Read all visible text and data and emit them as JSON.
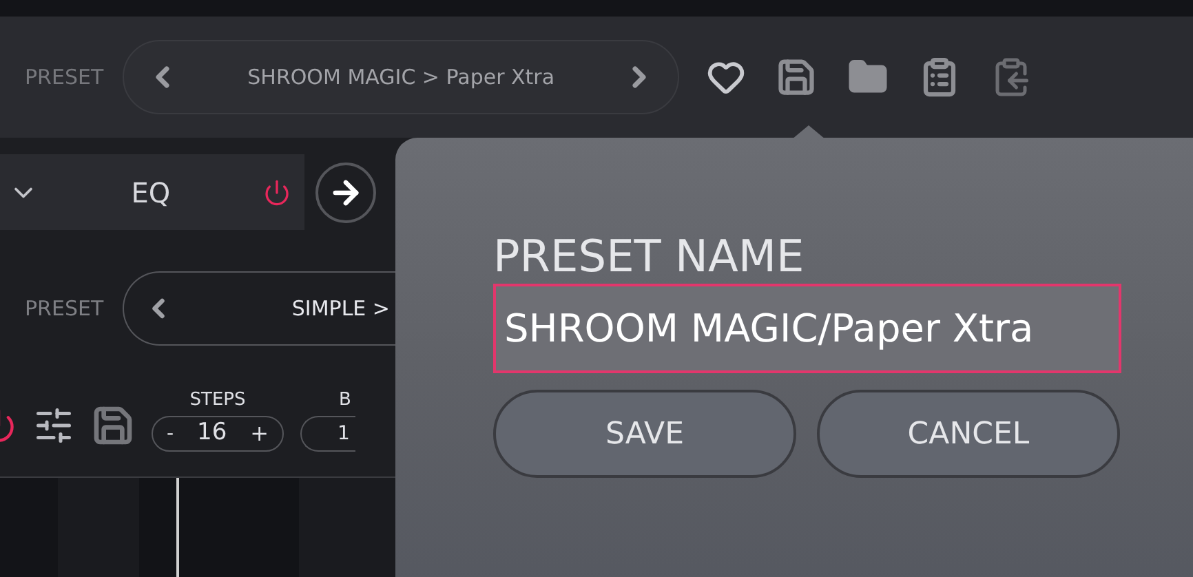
{
  "header": {
    "preset_label": "PRESET",
    "preset_name": "SHROOM MAGIC > Paper Xtra"
  },
  "eq_module": {
    "title": "EQ",
    "on": true
  },
  "sequencer": {
    "preset_label": "PRESET",
    "preset_name": "SIMPLE >",
    "power_on": true,
    "controls": [
      {
        "label": "STEPS",
        "minus": "-",
        "value": "16",
        "plus": "+"
      },
      {
        "label": "B",
        "value": "1"
      }
    ]
  },
  "save_dialog": {
    "title": "PRESET NAME",
    "value": "SHROOM MAGIC/Paper Xtra",
    "buttons": [
      "SAVE",
      "CANCEL"
    ]
  }
}
